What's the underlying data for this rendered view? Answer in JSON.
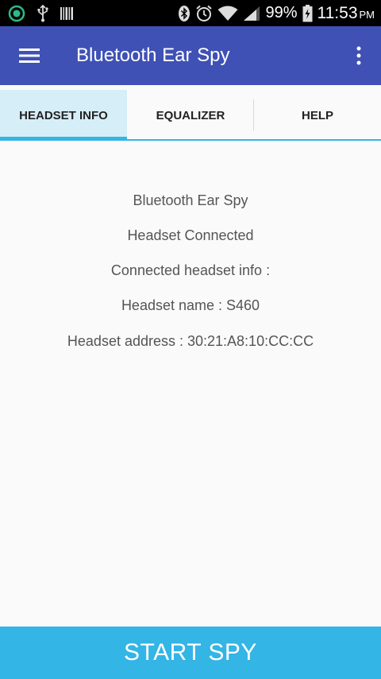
{
  "status_bar": {
    "icons_left": [
      "circle-notification-icon",
      "usb-icon",
      "barcode-icon"
    ],
    "icons_right": [
      "bluetooth-icon",
      "alarm-icon",
      "wifi-icon",
      "signal-icon",
      "battery-charging-icon"
    ],
    "battery": "99%",
    "time": "11:53",
    "ampm": "PM"
  },
  "app_bar": {
    "title": "Bluetooth Ear Spy",
    "color": "#3f51b5"
  },
  "tabs": [
    {
      "label": "HEADSET INFO",
      "active": true
    },
    {
      "label": "EQUALIZER",
      "active": false
    },
    {
      "label": "HELP",
      "active": false
    }
  ],
  "info": {
    "app_name": "Bluetooth Ear Spy",
    "status": "Headset Connected",
    "info_header": "Connected headset info :",
    "headset_name": "Headset name : S460",
    "headset_address": "Headset address : 30:21:A8:10:CC:CC"
  },
  "start_button": {
    "label": "START SPY",
    "color": "#33b5e5"
  }
}
